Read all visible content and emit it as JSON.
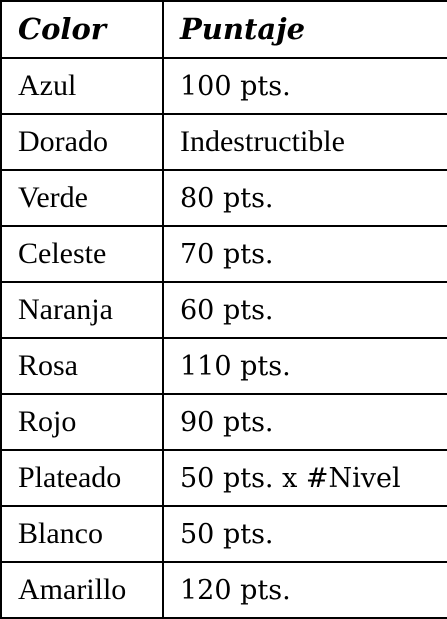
{
  "table": {
    "headers": {
      "color": "Color",
      "puntaje": "Puntaje"
    },
    "rows": [
      {
        "color": "Azul",
        "puntaje": "100 pts."
      },
      {
        "color": "Dorado",
        "puntaje": "Indestructible"
      },
      {
        "color": "Verde",
        "puntaje": "80 pts."
      },
      {
        "color": "Celeste",
        "puntaje": "70 pts."
      },
      {
        "color": "Naranja",
        "puntaje": "60 pts."
      },
      {
        "color": "Rosa",
        "puntaje": "110 pts."
      },
      {
        "color": "Rojo",
        "puntaje": "90 pts."
      },
      {
        "color": "Plateado",
        "puntaje": "50 pts. x #Nivel"
      },
      {
        "color": "Blanco",
        "puntaje": "50 pts."
      },
      {
        "color": "Amarillo",
        "puntaje": "120 pts."
      }
    ]
  },
  "colors": {
    "border": "#000000",
    "text": "#000000",
    "background": "#ffffff"
  }
}
